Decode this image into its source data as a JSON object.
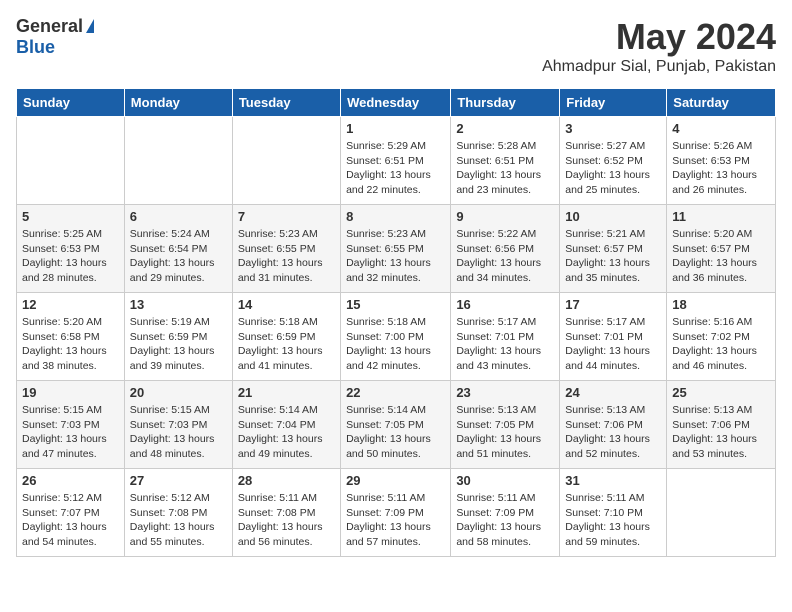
{
  "header": {
    "logo_general": "General",
    "logo_blue": "Blue",
    "month": "May 2024",
    "location": "Ahmadpur Sial, Punjab, Pakistan"
  },
  "weekdays": [
    "Sunday",
    "Monday",
    "Tuesday",
    "Wednesday",
    "Thursday",
    "Friday",
    "Saturday"
  ],
  "weeks": [
    [
      {
        "day": "",
        "content": ""
      },
      {
        "day": "",
        "content": ""
      },
      {
        "day": "",
        "content": ""
      },
      {
        "day": "1",
        "content": "Sunrise: 5:29 AM\nSunset: 6:51 PM\nDaylight: 13 hours\nand 22 minutes."
      },
      {
        "day": "2",
        "content": "Sunrise: 5:28 AM\nSunset: 6:51 PM\nDaylight: 13 hours\nand 23 minutes."
      },
      {
        "day": "3",
        "content": "Sunrise: 5:27 AM\nSunset: 6:52 PM\nDaylight: 13 hours\nand 25 minutes."
      },
      {
        "day": "4",
        "content": "Sunrise: 5:26 AM\nSunset: 6:53 PM\nDaylight: 13 hours\nand 26 minutes."
      }
    ],
    [
      {
        "day": "5",
        "content": "Sunrise: 5:25 AM\nSunset: 6:53 PM\nDaylight: 13 hours\nand 28 minutes."
      },
      {
        "day": "6",
        "content": "Sunrise: 5:24 AM\nSunset: 6:54 PM\nDaylight: 13 hours\nand 29 minutes."
      },
      {
        "day": "7",
        "content": "Sunrise: 5:23 AM\nSunset: 6:55 PM\nDaylight: 13 hours\nand 31 minutes."
      },
      {
        "day": "8",
        "content": "Sunrise: 5:23 AM\nSunset: 6:55 PM\nDaylight: 13 hours\nand 32 minutes."
      },
      {
        "day": "9",
        "content": "Sunrise: 5:22 AM\nSunset: 6:56 PM\nDaylight: 13 hours\nand 34 minutes."
      },
      {
        "day": "10",
        "content": "Sunrise: 5:21 AM\nSunset: 6:57 PM\nDaylight: 13 hours\nand 35 minutes."
      },
      {
        "day": "11",
        "content": "Sunrise: 5:20 AM\nSunset: 6:57 PM\nDaylight: 13 hours\nand 36 minutes."
      }
    ],
    [
      {
        "day": "12",
        "content": "Sunrise: 5:20 AM\nSunset: 6:58 PM\nDaylight: 13 hours\nand 38 minutes."
      },
      {
        "day": "13",
        "content": "Sunrise: 5:19 AM\nSunset: 6:59 PM\nDaylight: 13 hours\nand 39 minutes."
      },
      {
        "day": "14",
        "content": "Sunrise: 5:18 AM\nSunset: 6:59 PM\nDaylight: 13 hours\nand 41 minutes."
      },
      {
        "day": "15",
        "content": "Sunrise: 5:18 AM\nSunset: 7:00 PM\nDaylight: 13 hours\nand 42 minutes."
      },
      {
        "day": "16",
        "content": "Sunrise: 5:17 AM\nSunset: 7:01 PM\nDaylight: 13 hours\nand 43 minutes."
      },
      {
        "day": "17",
        "content": "Sunrise: 5:17 AM\nSunset: 7:01 PM\nDaylight: 13 hours\nand 44 minutes."
      },
      {
        "day": "18",
        "content": "Sunrise: 5:16 AM\nSunset: 7:02 PM\nDaylight: 13 hours\nand 46 minutes."
      }
    ],
    [
      {
        "day": "19",
        "content": "Sunrise: 5:15 AM\nSunset: 7:03 PM\nDaylight: 13 hours\nand 47 minutes."
      },
      {
        "day": "20",
        "content": "Sunrise: 5:15 AM\nSunset: 7:03 PM\nDaylight: 13 hours\nand 48 minutes."
      },
      {
        "day": "21",
        "content": "Sunrise: 5:14 AM\nSunset: 7:04 PM\nDaylight: 13 hours\nand 49 minutes."
      },
      {
        "day": "22",
        "content": "Sunrise: 5:14 AM\nSunset: 7:05 PM\nDaylight: 13 hours\nand 50 minutes."
      },
      {
        "day": "23",
        "content": "Sunrise: 5:13 AM\nSunset: 7:05 PM\nDaylight: 13 hours\nand 51 minutes."
      },
      {
        "day": "24",
        "content": "Sunrise: 5:13 AM\nSunset: 7:06 PM\nDaylight: 13 hours\nand 52 minutes."
      },
      {
        "day": "25",
        "content": "Sunrise: 5:13 AM\nSunset: 7:06 PM\nDaylight: 13 hours\nand 53 minutes."
      }
    ],
    [
      {
        "day": "26",
        "content": "Sunrise: 5:12 AM\nSunset: 7:07 PM\nDaylight: 13 hours\nand 54 minutes."
      },
      {
        "day": "27",
        "content": "Sunrise: 5:12 AM\nSunset: 7:08 PM\nDaylight: 13 hours\nand 55 minutes."
      },
      {
        "day": "28",
        "content": "Sunrise: 5:11 AM\nSunset: 7:08 PM\nDaylight: 13 hours\nand 56 minutes."
      },
      {
        "day": "29",
        "content": "Sunrise: 5:11 AM\nSunset: 7:09 PM\nDaylight: 13 hours\nand 57 minutes."
      },
      {
        "day": "30",
        "content": "Sunrise: 5:11 AM\nSunset: 7:09 PM\nDaylight: 13 hours\nand 58 minutes."
      },
      {
        "day": "31",
        "content": "Sunrise: 5:11 AM\nSunset: 7:10 PM\nDaylight: 13 hours\nand 59 minutes."
      },
      {
        "day": "",
        "content": ""
      }
    ]
  ]
}
